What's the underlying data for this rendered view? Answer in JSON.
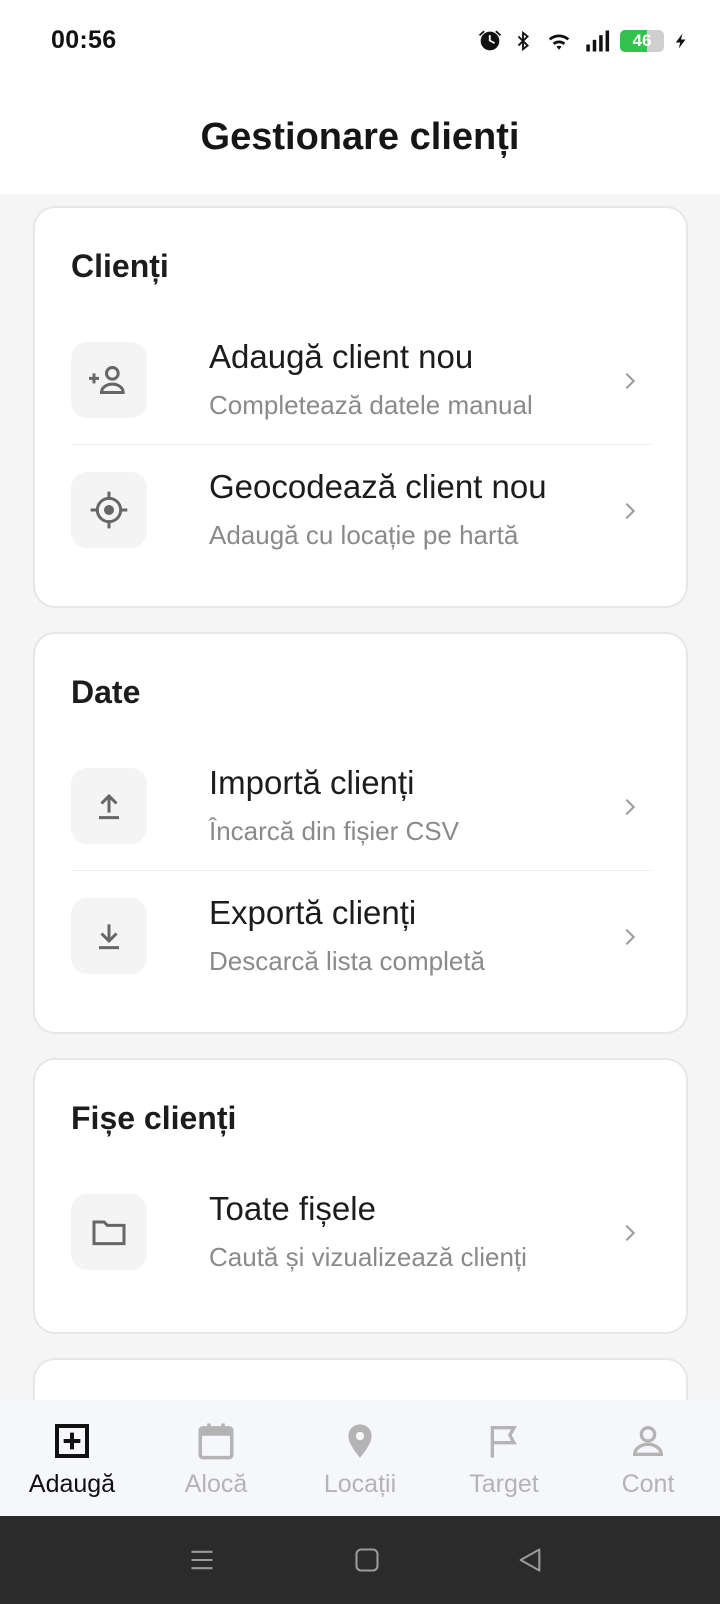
{
  "status_bar": {
    "time": "00:56",
    "battery": "46"
  },
  "header": {
    "title": "Gestionare clienți"
  },
  "sections": [
    {
      "title": "Clienți",
      "items": [
        {
          "icon": "add-person-icon",
          "title": "Adaugă client nou",
          "subtitle": "Completează datele manual"
        },
        {
          "icon": "target-location-icon",
          "title": "Geocodează client nou",
          "subtitle": "Adaugă cu locație pe hartă"
        }
      ]
    },
    {
      "title": "Date",
      "items": [
        {
          "icon": "upload-icon",
          "title": "Importă clienți",
          "subtitle": "Încarcă din fișier CSV"
        },
        {
          "icon": "download-icon",
          "title": "Exportă clienți",
          "subtitle": "Descarcă lista completă"
        }
      ]
    },
    {
      "title": "Fișe clienți",
      "items": [
        {
          "icon": "folder-icon",
          "title": "Toate fișele",
          "subtitle": "Caută și vizualizează clienți"
        }
      ]
    }
  ],
  "bottom_nav": [
    {
      "label": "Adaugă",
      "icon": "add-box-icon",
      "active": true
    },
    {
      "label": "Alocă",
      "icon": "calendar-icon",
      "active": false
    },
    {
      "label": "Locații",
      "icon": "location-pin-icon",
      "active": false
    },
    {
      "label": "Target",
      "icon": "flag-icon",
      "active": false
    },
    {
      "label": "Cont",
      "icon": "person-icon",
      "active": false
    }
  ],
  "colors": {
    "active": "#111111",
    "inactive": "#b4b4b4",
    "battery": "#33c24d",
    "subtitle": "#8a8a8a"
  }
}
